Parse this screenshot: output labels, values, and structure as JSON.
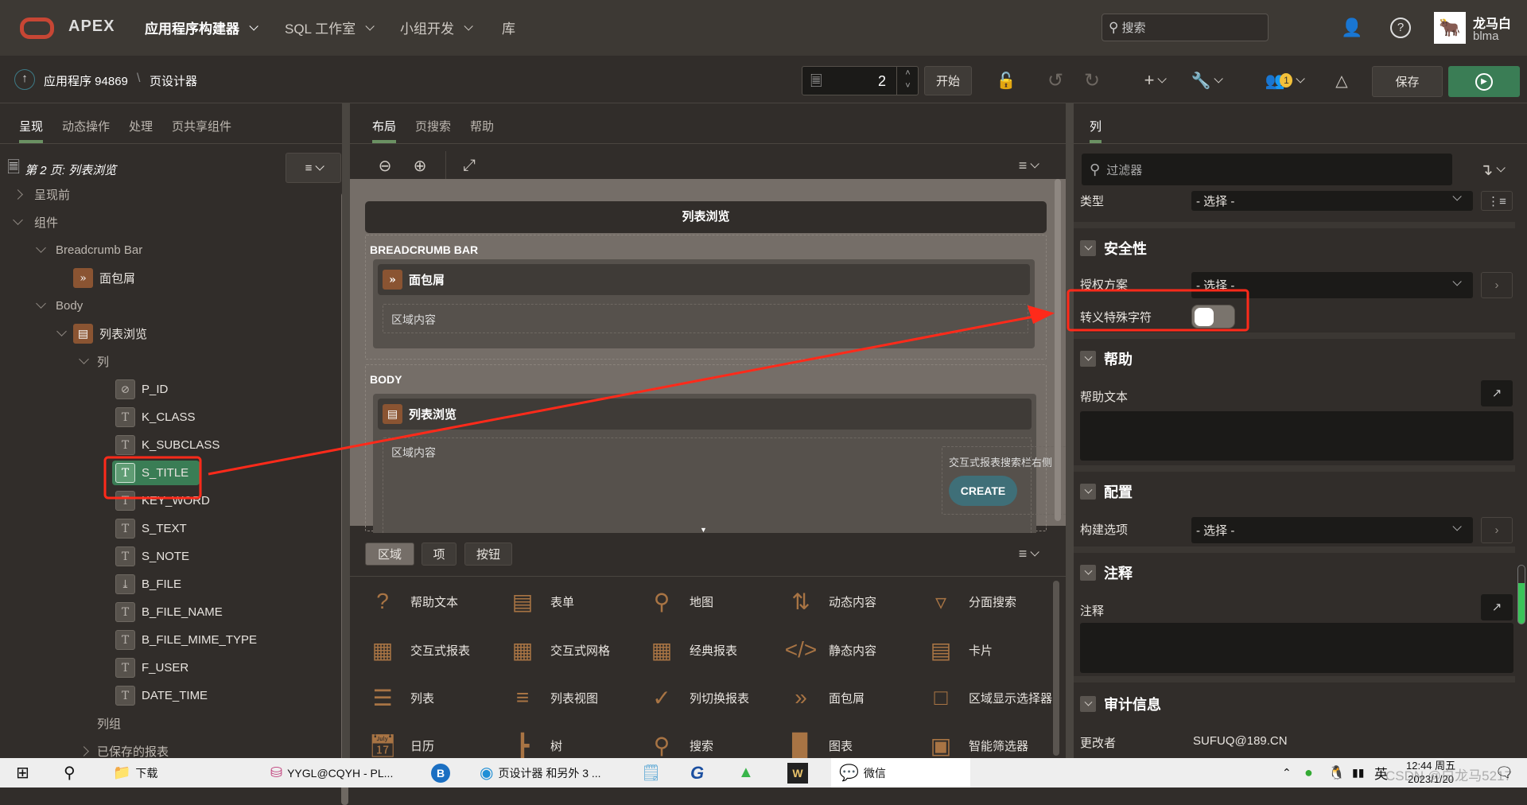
{
  "header": {
    "logo": "APEX",
    "menus": [
      {
        "label": "应用程序构建器",
        "active": true
      },
      {
        "label": "SQL 工作室"
      },
      {
        "label": "小组开发"
      },
      {
        "label": "库"
      }
    ],
    "search_placeholder": "搜索",
    "user_name": "龙马白",
    "user_id": "blma"
  },
  "toolbar": {
    "breadcrumb_app": "应用程序 94869",
    "breadcrumb_sep": "\\",
    "breadcrumb_page": "页设计器",
    "page_number": "2",
    "start_label": "开始",
    "notification_count": "1",
    "save_label": "保存",
    "run_color": "#3a7d55"
  },
  "left": {
    "tabs": [
      "呈现",
      "动态操作",
      "处理",
      "页共享组件"
    ],
    "page_title": "第 2 页: 列表浏览",
    "tree": [
      {
        "label": "呈现前",
        "level": 0,
        "toggle": "right"
      },
      {
        "label": "组件",
        "level": 0,
        "toggle": "down"
      },
      {
        "label": "Breadcrumb Bar",
        "level": 1,
        "toggle": "down"
      },
      {
        "label": "面包屑",
        "level": 2,
        "icon": "breadcrumb-icon"
      },
      {
        "label": "Body",
        "level": 1,
        "toggle": "down"
      },
      {
        "label": "列表浏览",
        "level": 2,
        "toggle": "down",
        "icon": "report-icon"
      },
      {
        "label": "列",
        "level": 3,
        "toggle": "down"
      },
      {
        "label": "P_ID",
        "level": 4,
        "icon": "hidden-icon"
      },
      {
        "label": "K_CLASS",
        "level": 4,
        "icon": "text-icon"
      },
      {
        "label": "K_SUBCLASS",
        "level": 4,
        "icon": "text-icon"
      },
      {
        "label": "S_TITLE",
        "level": 4,
        "icon": "text-icon",
        "selected": true
      },
      {
        "label": "KEY_WORD",
        "level": 4,
        "icon": "text-icon"
      },
      {
        "label": "S_TEXT",
        "level": 4,
        "icon": "text-icon"
      },
      {
        "label": "S_NOTE",
        "level": 4,
        "icon": "text-icon"
      },
      {
        "label": "B_FILE",
        "level": 4,
        "icon": "download-icon"
      },
      {
        "label": "B_FILE_NAME",
        "level": 4,
        "icon": "text-icon"
      },
      {
        "label": "B_FILE_MIME_TYPE",
        "level": 4,
        "icon": "text-icon"
      },
      {
        "label": "F_USER",
        "level": 4,
        "icon": "text-icon"
      },
      {
        "label": "DATE_TIME",
        "level": 4,
        "icon": "text-icon"
      },
      {
        "label": "列组",
        "level": 3
      },
      {
        "label": "已保存的报表",
        "level": 3,
        "toggle": "right"
      }
    ]
  },
  "center": {
    "tabs": [
      "布局",
      "页搜索",
      "帮助"
    ],
    "canvas": {
      "page_title": "列表浏览",
      "breadcrumb_section": "BREADCRUMB BAR",
      "breadcrumb_region": "面包屑",
      "region_content": "区域内容",
      "body_section": "BODY",
      "body_region": "列表浏览",
      "body_content": "区域内容",
      "search_bar_right": "交互式报表搜索栏右侧",
      "create_button": "CREATE"
    },
    "gallery_tabs": [
      "区域",
      "项",
      "按钮"
    ],
    "gallery": [
      {
        "label": "帮助文本",
        "icon": "help-icon"
      },
      {
        "label": "表单",
        "icon": "form-icon"
      },
      {
        "label": "地图",
        "icon": "map-icon"
      },
      {
        "label": "动态内容",
        "icon": "dynamic-content-icon"
      },
      {
        "label": "分面搜索",
        "icon": "faceted-search-icon"
      },
      {
        "label": "交互式报表",
        "icon": "interactive-report-icon"
      },
      {
        "label": "交互式网格",
        "icon": "interactive-grid-icon"
      },
      {
        "label": "经典报表",
        "icon": "classic-report-icon"
      },
      {
        "label": "静态内容",
        "icon": "static-content-icon"
      },
      {
        "label": "卡片",
        "icon": "cards-icon"
      },
      {
        "label": "列表",
        "icon": "list-icon"
      },
      {
        "label": "列表视图",
        "icon": "list-view-icon"
      },
      {
        "label": "列切换报表",
        "icon": "column-toggle-icon"
      },
      {
        "label": "面包屑",
        "icon": "breadcrumb-icon"
      },
      {
        "label": "区域显示选择器",
        "icon": "region-selector-icon"
      },
      {
        "label": "日历",
        "icon": "calendar-icon"
      },
      {
        "label": "树",
        "icon": "tree-icon"
      },
      {
        "label": "搜索",
        "icon": "search-icon"
      },
      {
        "label": "图表",
        "icon": "chart-icon"
      },
      {
        "label": "智能筛选器",
        "icon": "smart-filter-icon"
      }
    ]
  },
  "right": {
    "tab": "列",
    "filter_placeholder": "过滤器",
    "type_label": "类型",
    "select_placeholder": "- 选择 -",
    "security": {
      "title": "安全性",
      "auth_label": "授权方案",
      "auth_value": "- 选择 -",
      "escape_label": "转义特殊字符",
      "escape_on": false
    },
    "help": {
      "title": "帮助",
      "text_label": "帮助文本",
      "text_value": ""
    },
    "config": {
      "title": "配置",
      "build_label": "构建选项",
      "build_value": "- 选择 -"
    },
    "comments": {
      "title": "注释",
      "label": "注释",
      "value": ""
    },
    "audit": {
      "title": "审计信息",
      "changed_by_label": "更改者",
      "changed_by_value": "SUFUQ@189.CN"
    }
  },
  "taskbar": {
    "items": [
      "下载",
      "YYGL@CQYH - PL...",
      "页设计器 和另外 3 ...",
      "微信"
    ],
    "ime": "英",
    "time": "12:44 周五",
    "date": "2023/1/20",
    "watermark": "CSDN @白龙马5217"
  },
  "annotation_color": "#ff2a1a"
}
